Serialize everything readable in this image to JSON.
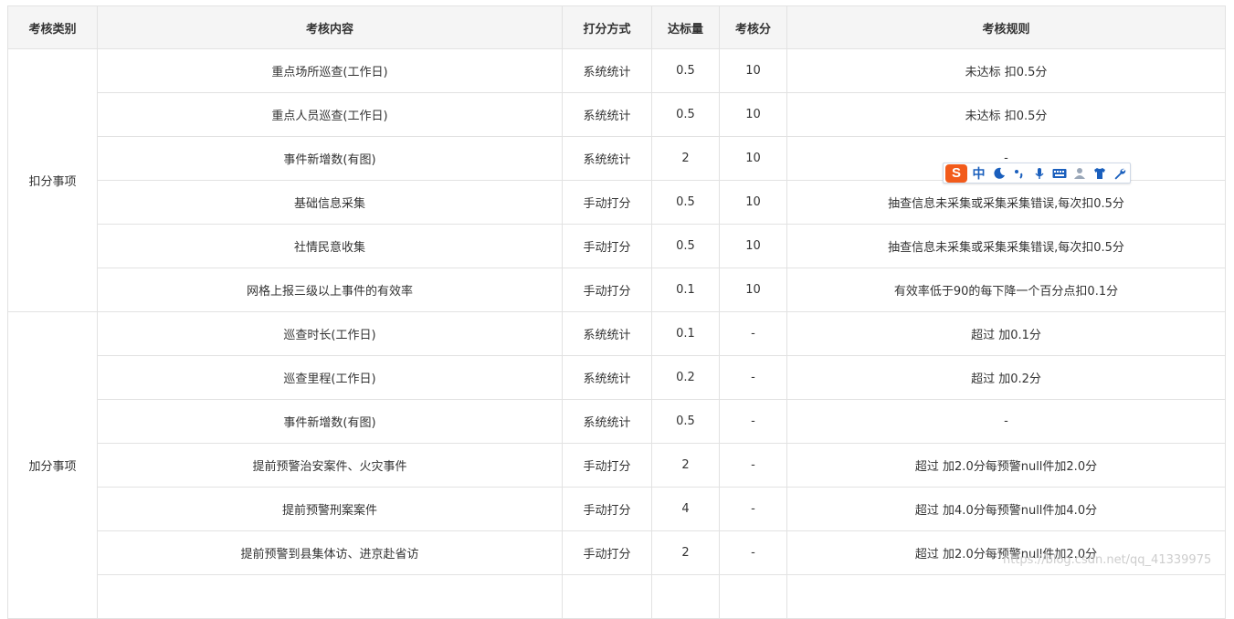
{
  "table": {
    "headers": [
      "考核类别",
      "考核内容",
      "打分方式",
      "达标量",
      "考核分",
      "考核规则"
    ],
    "groups": [
      {
        "category": "扣分事项",
        "rows": [
          {
            "content": "重点场所巡查(工作日)",
            "method": "系统统计",
            "target": "0.5",
            "score": "10",
            "rule": "未达标 扣0.5分"
          },
          {
            "content": "重点人员巡查(工作日)",
            "method": "系统统计",
            "target": "0.5",
            "score": "10",
            "rule": "未达标 扣0.5分"
          },
          {
            "content": "事件新增数(有图)",
            "method": "系统统计",
            "target": "2",
            "score": "10",
            "rule": "-"
          },
          {
            "content": "基础信息采集",
            "method": "手动打分",
            "target": "0.5",
            "score": "10",
            "rule": "抽查信息未采集或采集采集错误,每次扣0.5分"
          },
          {
            "content": "社情民意收集",
            "method": "手动打分",
            "target": "0.5",
            "score": "10",
            "rule": "抽查信息未采集或采集采集错误,每次扣0.5分"
          },
          {
            "content": "网格上报三级以上事件的有效率",
            "method": "手动打分",
            "target": "0.1",
            "score": "10",
            "rule": "有效率低于90的每下降一个百分点扣0.1分"
          }
        ]
      },
      {
        "category": "加分事项",
        "rows": [
          {
            "content": "巡查时长(工作日)",
            "method": "系统统计",
            "target": "0.1",
            "score": "-",
            "rule": "超过 加0.1分"
          },
          {
            "content": "巡查里程(工作日)",
            "method": "系统统计",
            "target": "0.2",
            "score": "-",
            "rule": "超过 加0.2分"
          },
          {
            "content": "事件新增数(有图)",
            "method": "系统统计",
            "target": "0.5",
            "score": "-",
            "rule": "-"
          },
          {
            "content": "提前预警治安案件、火灾事件",
            "method": "手动打分",
            "target": "2",
            "score": "-",
            "rule": "超过 加2.0分每预警null件加2.0分"
          },
          {
            "content": "提前预警刑案案件",
            "method": "手动打分",
            "target": "4",
            "score": "-",
            "rule": "超过 加4.0分每预警null件加4.0分"
          },
          {
            "content": "提前预警到县集体访、进京赴省访",
            "method": "手动打分",
            "target": "2",
            "score": "-",
            "rule": "超过 加2.0分每预警null件加2.0分"
          },
          {
            "content": "",
            "method": "",
            "target": "",
            "score": "",
            "rule": ""
          }
        ]
      }
    ]
  },
  "ime_toolbar": {
    "logo": "S",
    "lang": "中",
    "icons": [
      "moon-icon",
      "punctuation-icon",
      "microphone-icon",
      "keyboard-icon",
      "user-icon",
      "shirt-icon",
      "wrench-icon"
    ]
  },
  "watermark": "https://blog.csdn.net/qq_41339975",
  "colors": {
    "header_bg": "#f5f5f5",
    "border": "#e2e2e2",
    "ime_logo": "#f25b1b",
    "ime_icon": "#1a5fbd"
  }
}
